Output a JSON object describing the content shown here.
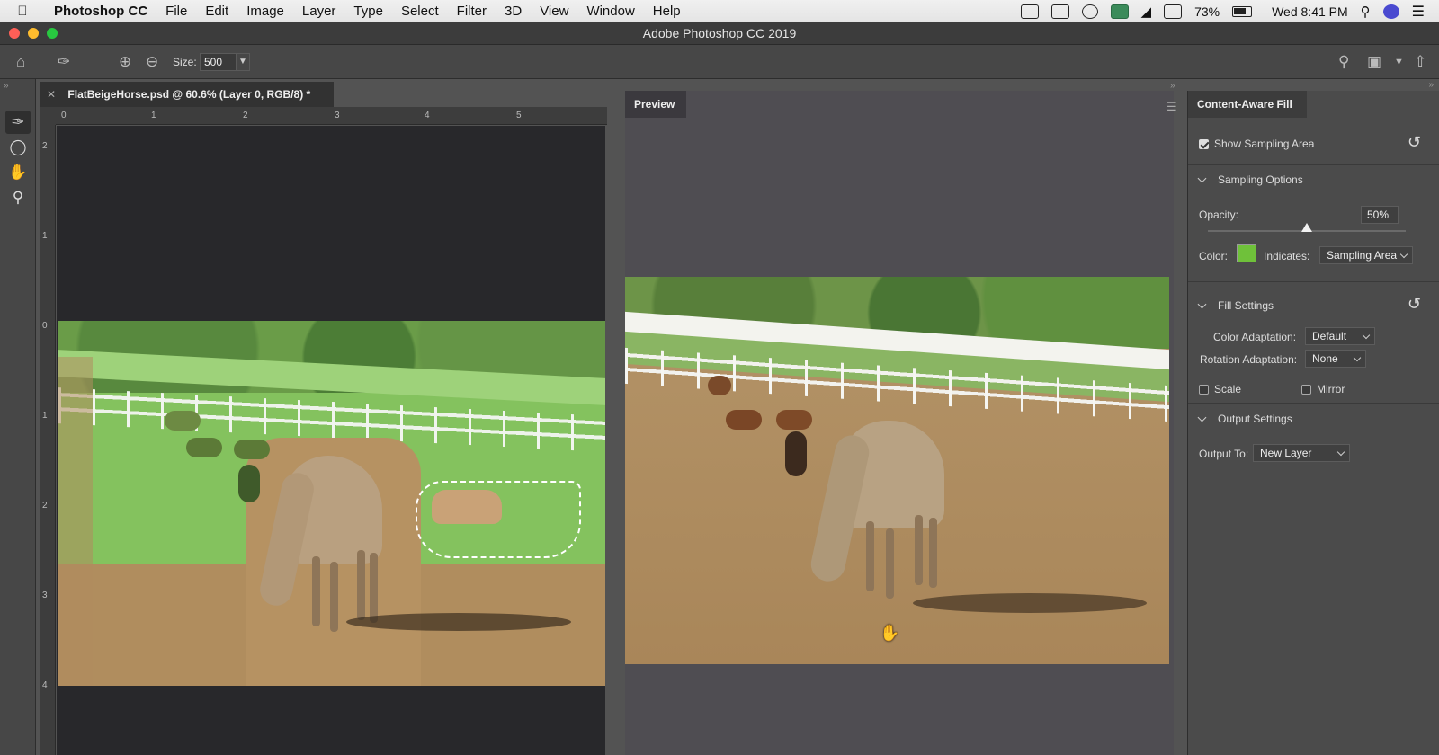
{
  "menubar": {
    "app_name": "Photoshop CC",
    "menus": [
      "File",
      "Edit",
      "Image",
      "Layer",
      "Type",
      "Select",
      "Filter",
      "3D",
      "View",
      "Window",
      "Help"
    ],
    "battery": "73%",
    "clock": "Wed 8:41 PM"
  },
  "window": {
    "title": "Adobe Photoshop CC 2019"
  },
  "options": {
    "size_label": "Size:",
    "size_value": "500"
  },
  "document": {
    "tab_title": "FlatBeigeHorse.psd @ 60.6% (Layer 0, RGB/8) *",
    "ruler_h": [
      "0",
      "1",
      "2",
      "3",
      "4",
      "5"
    ],
    "ruler_v": [
      "2",
      "1",
      "0",
      "1",
      "2",
      "3",
      "4"
    ]
  },
  "preview": {
    "tab_label": "Preview"
  },
  "panel": {
    "tab_label": "Content-Aware Fill",
    "show_sampling_label": "Show Sampling Area",
    "show_sampling_checked": true,
    "sampling_options_label": "Sampling Options",
    "opacity_label": "Opacity:",
    "opacity_value": "50%",
    "opacity_level": 0.5,
    "color_label": "Color:",
    "color_swatch": "#6fc13a",
    "indicates_label": "Indicates:",
    "indicates_value": "Sampling Area",
    "fill_settings_label": "Fill Settings",
    "color_adaptation_label": "Color Adaptation:",
    "color_adaptation_value": "Default",
    "rotation_adaptation_label": "Rotation Adaptation:",
    "rotation_adaptation_value": "None",
    "scale_label": "Scale",
    "mirror_label": "Mirror",
    "output_settings_label": "Output Settings",
    "output_to_label": "Output To:",
    "output_to_value": "New Layer"
  },
  "colors": {
    "accent_green": "#6fc13a",
    "ui_dark": "#474747"
  }
}
